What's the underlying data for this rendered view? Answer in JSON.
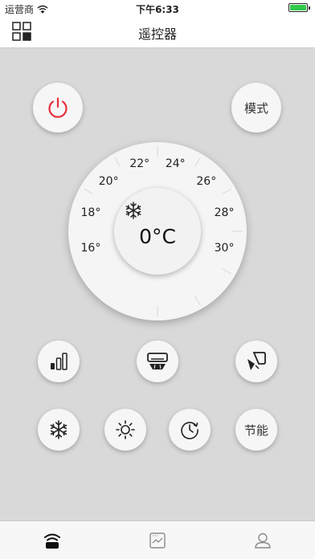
{
  "status_bar": {
    "carrier": "运营商",
    "time": "下午6:33",
    "wifi_icon": "wifi-icon",
    "battery_icon": "battery-icon"
  },
  "nav": {
    "title": "遥控器",
    "menu_icon": "grid-menu-icon"
  },
  "controls": {
    "power_icon": "power-icon",
    "power_color": "#e8303c",
    "mode_label": "模式"
  },
  "dial": {
    "temperature_marks": [
      "16°",
      "18°",
      "20°",
      "22°",
      "24°",
      "26°",
      "28°",
      "30°"
    ],
    "current_temperature": "0°C",
    "mode_icon": "snowflake-icon"
  },
  "row1_buttons": [
    "fan-speed-icon",
    "ac-vertical-swing-icon",
    "ac-horizontal-swing-icon"
  ],
  "row2_buttons": {
    "icons": [
      "snowflake-icon",
      "sun-icon",
      "timer-icon"
    ],
    "energy_saving_label": "节能"
  },
  "tab_bar": {
    "items": [
      "remote-icon",
      "chart-icon",
      "user-icon"
    ],
    "active_index": 0
  }
}
